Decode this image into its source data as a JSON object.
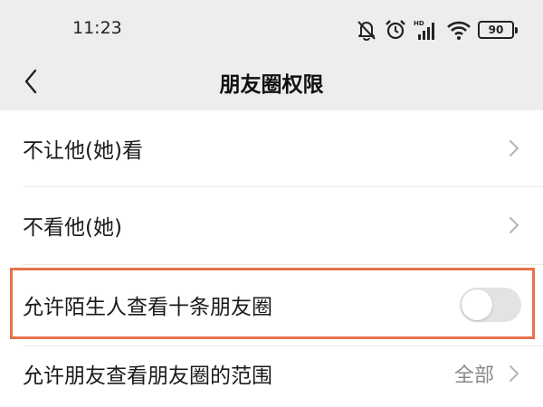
{
  "status_bar": {
    "time": "11:23",
    "battery": "90",
    "icons": [
      "mute-bell-icon",
      "alarm-icon",
      "hd-signal-icon",
      "wifi-icon",
      "battery-icon"
    ]
  },
  "nav": {
    "title": "朋友圈权限",
    "back_icon": "back-chevron-icon"
  },
  "rows": [
    {
      "label": "不让他(她)看",
      "value": "",
      "control": "chevron"
    },
    {
      "label": "不看他(她)",
      "value": "",
      "control": "chevron"
    },
    {
      "label": "允许陌生人查看十条朋友圈",
      "value": "",
      "control": "toggle",
      "toggle_on": false,
      "highlighted": true
    },
    {
      "label": "允许朋友查看朋友圈的范围",
      "value": "全部",
      "control": "chevron"
    }
  ],
  "colors": {
    "background": "#ededed",
    "card": "#ffffff",
    "highlight": "#e9724a",
    "toggle_off": "#e3e3e3",
    "secondary_text": "#8a8a8a"
  }
}
